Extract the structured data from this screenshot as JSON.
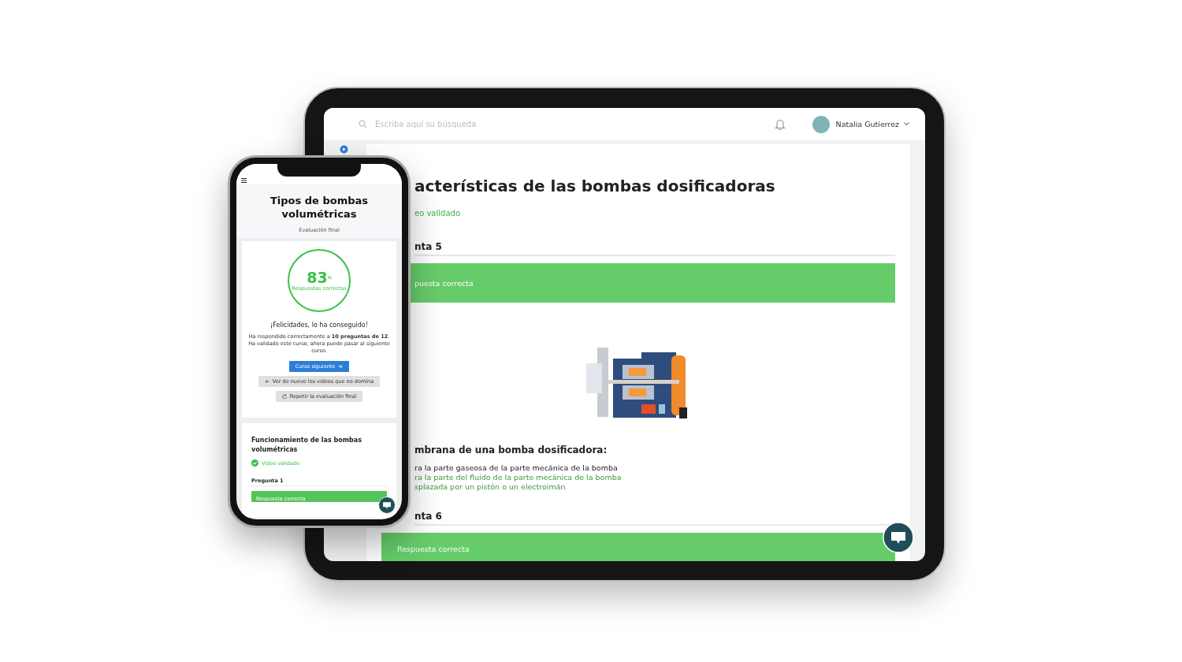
{
  "tablet": {
    "search": {
      "placeholder": "Escriba aquí su búsqueda"
    },
    "user": {
      "name": "Natalia Gutierrez"
    },
    "lesson": {
      "title": "acterísticas de las bombas dosificadoras",
      "status": "eo validado"
    },
    "questions": [
      {
        "label": "nta 5",
        "result": "puesta correcta",
        "correct": true,
        "illustration": true,
        "prompt": "mbrana de una bomba dosificadora:",
        "options": [
          {
            "text": "ra la parte gaseosa de la parte mecánica de la bomba",
            "correct": false
          },
          {
            "text": "ra la parte del fluido de la parte mecánica de la bomba",
            "correct": true
          },
          {
            "text": "splazada por un pistón o un electroimán",
            "correct": true
          }
        ]
      },
      {
        "label": "nta 6",
        "result": "Respuesta correcta",
        "correct": true,
        "illustration": false
      }
    ]
  },
  "phone": {
    "course_title": "Tipos de bombas volumétricas",
    "subtitle": "Evaluación final",
    "score": {
      "value": "83",
      "unit": "%",
      "caption": "Respuestas correctas"
    },
    "message": "¡Felicidades, lo ha conseguido!",
    "summary": "Ha respondido correctamente a **10 preguntas de 12**. Ha validado este curso, ahora puede pasar al siguiente curso.",
    "buttons": [
      {
        "label": "Curso siguiente",
        "kind": "next"
      },
      {
        "label": "Ver de nuevo los videos que no domina",
        "kind": "back"
      },
      {
        "label": "Repetir la evaluación final",
        "kind": "retry"
      }
    ],
    "lesson": {
      "title": "Funcionamiento de las bombas volumétricas",
      "status": "Video validado",
      "question": "Pregunta 1",
      "result": "Respuesta correcta",
      "correct": true
    }
  }
}
